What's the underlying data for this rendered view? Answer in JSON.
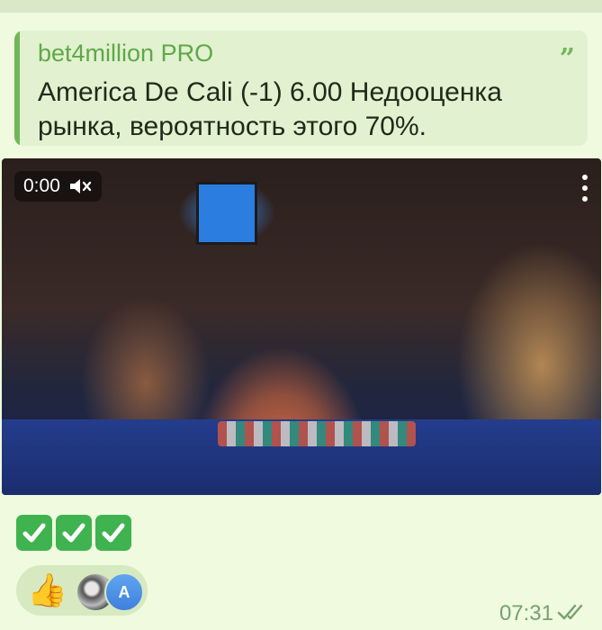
{
  "message": {
    "quote": {
      "author": "bet4million PRO",
      "text": "America De Cali (-1) 6.00 Недооценка рынка, вероятность этого 70%.",
      "icon": "quote-icon"
    },
    "video": {
      "time": "0:00",
      "mute_icon": "muted-speaker-icon",
      "menu_icon": "more-vertical-icon"
    },
    "checks": [
      "✔",
      "✔",
      "✔"
    ],
    "reaction": {
      "emoji": "👍",
      "avatar_letter": "A"
    },
    "timestamp": "07:31",
    "status_icon": "double-check-icon",
    "colors": {
      "accent": "#5ea849",
      "bubble": "#effadf",
      "check": "#3fb34f"
    }
  }
}
